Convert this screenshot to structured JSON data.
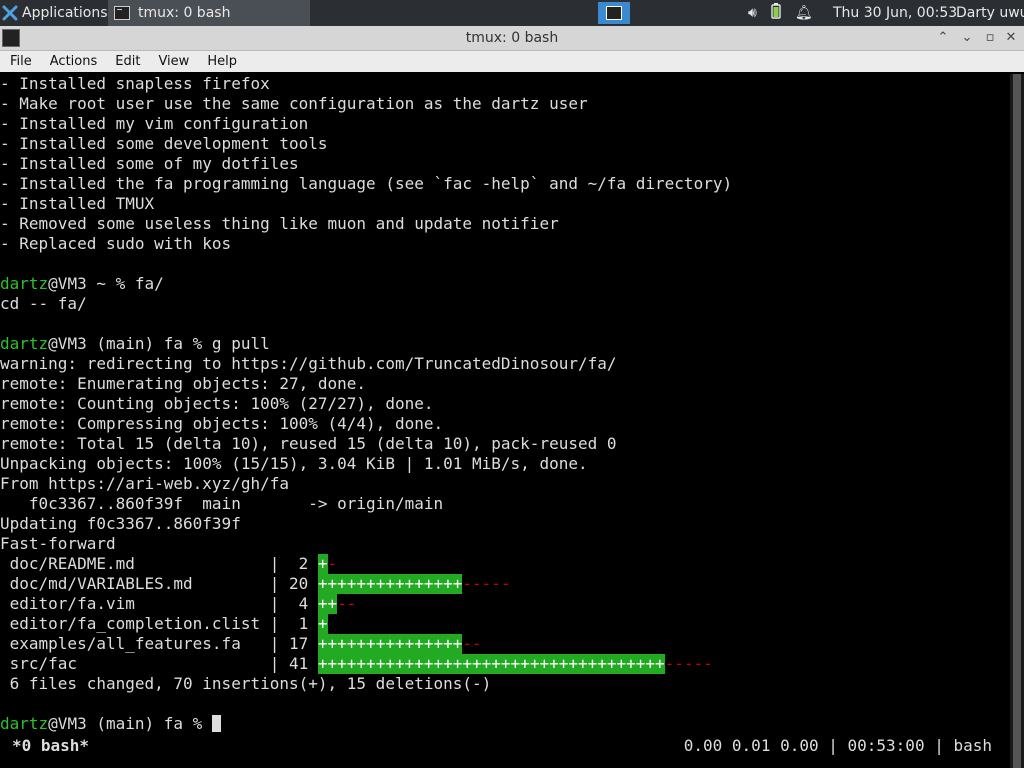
{
  "panel": {
    "applications_label": "Applications",
    "task_title": "tmux: 0 bash",
    "clock": "Thu 30 Jun, 00:53",
    "user": "Darty uwu"
  },
  "window": {
    "title": "tmux: 0 bash",
    "minimize": "⌃",
    "restore": "⌄",
    "maximize": "▫",
    "close": "✕"
  },
  "menu": [
    "File",
    "Actions",
    "Edit",
    "View",
    "Help"
  ],
  "terminal": {
    "lines": [
      "- Installed snapless firefox",
      "- Make root user use the same configuration as the dartz user",
      "- Installed my vim configuration",
      "- Installed some development tools",
      "- Installed some of my dotfiles",
      "- Installed the fa programming language (see `fac -help` and ~/fa directory)",
      "- Installed TMUX",
      "- Removed some useless thing like muon and update notifier",
      "- Replaced sudo with kos",
      ""
    ],
    "prompt1": {
      "user": "dartz",
      "rest": "@VM3 ~ % fa/"
    },
    "after_prompt1": [
      "cd -- fa/",
      ""
    ],
    "prompt2": {
      "user": "dartz",
      "rest": "@VM3 (main) fa % g pull"
    },
    "pull_output": [
      "warning: redirecting to https://github.com/TruncatedDinosour/fa/",
      "remote: Enumerating objects: 27, done.",
      "remote: Counting objects: 100% (27/27), done.",
      "remote: Compressing objects: 100% (4/4), done.",
      "remote: Total 15 (delta 10), reused 15 (delta 10), pack-reused 0",
      "Unpacking objects: 100% (15/15), 3.04 KiB | 1.01 MiB/s, done.",
      "From https://ari-web.xyz/gh/fa",
      "   f0c3367..860f39f  main       -> origin/main",
      "Updating f0c3367..860f39f",
      "Fast-forward"
    ],
    "diffstat": [
      {
        "file": " doc/README.md              ",
        "count": "|  2 ",
        "plus": "+",
        "minus": "-"
      },
      {
        "file": " doc/md/VARIABLES.md        ",
        "count": "| 20 ",
        "plus": "+++++++++++++++",
        "minus": "-----"
      },
      {
        "file": " editor/fa.vim              ",
        "count": "|  4 ",
        "plus": "++",
        "minus": "--"
      },
      {
        "file": " editor/fa_completion.clist ",
        "count": "|  1 ",
        "plus": "+",
        "minus": ""
      },
      {
        "file": " examples/all_features.fa   ",
        "count": "| 17 ",
        "plus": "+++++++++++++++",
        "minus": "--"
      },
      {
        "file": " src/fac                    ",
        "count": "| 41 ",
        "plus": "++++++++++++++++++++++++++++++++++++",
        "minus": "-----"
      }
    ],
    "summary": " 6 files changed, 70 insertions(+), 15 deletions(-)",
    "prompt3": {
      "user": "dartz",
      "rest": "@VM3 (main) fa % "
    }
  },
  "status": {
    "left": "*0 bash*",
    "right": "0.00 0.01 0.00 | 00:53:00 | bash"
  }
}
